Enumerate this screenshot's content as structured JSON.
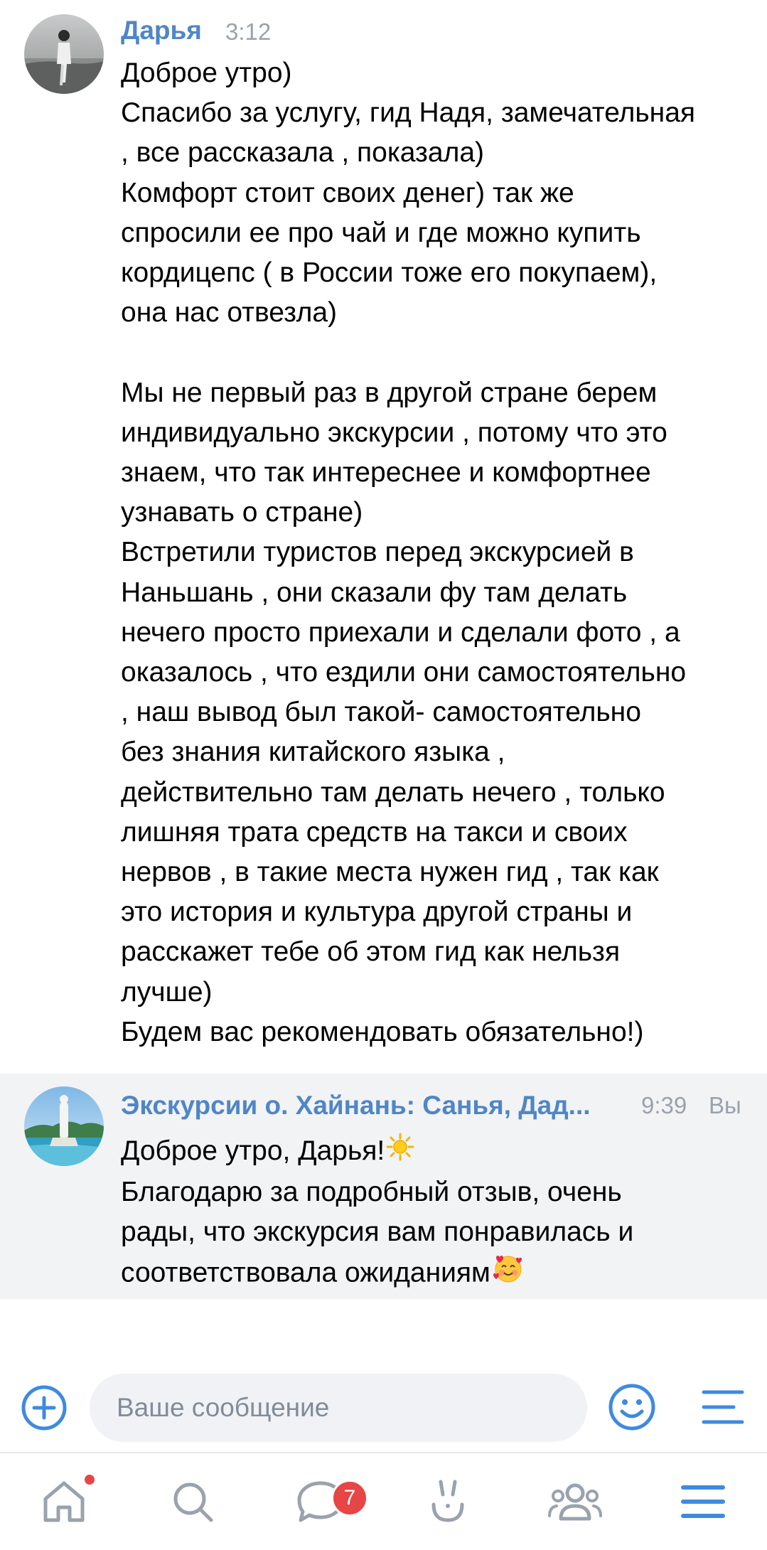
{
  "messages": [
    {
      "author": "Дарья",
      "time": "3:12",
      "lines": [
        "Доброе утро)",
        "Спасибо за услугу, гид Надя, замечательная",
        ", все рассказала , показала)",
        "Комфорт стоит своих денег) так же",
        "спросили ее про чай и где можно купить",
        "кордицепс ( в России тоже его покупаем),",
        "она нас отвезла)",
        "",
        "Мы не первый раз в другой стране берем",
        "индивидуально экскурсии , потому что это",
        "знаем, что так интереснее и комфортнее",
        "узнавать о стране)",
        "Встретили туристов перед экскурсией в",
        "Наньшань , они сказали фу там делать",
        "нечего просто приехали и сделали фото , а",
        "оказалось , что ездили они самостоятельно",
        ", наш вывод был такой- самостоятельно",
        "без знания китайского языка ,",
        "действительно там делать нечего , только",
        "лишняя трата средств на такси и своих",
        "нервов , в такие места нужен гид , так как",
        "это история и культура другой страны и",
        "расскажет тебе об этом гид как нельзя",
        "лучше)",
        "Будем вас рекомендовать обязательно!)"
      ]
    },
    {
      "author": "Экскурсии о. Хайнань: Санья, Дад...",
      "time": "9:39",
      "you_label": "Вы",
      "lines": [
        "Доброе утро, Дарья!",
        "Благодарю за подробный отзыв, очень",
        "рады, что экскурсия вам понравилась и",
        "соответствовала ожиданиям"
      ],
      "emojis": [
        "sun-emoji",
        "smiling-face-with-hearts-emoji"
      ]
    }
  ],
  "composer": {
    "placeholder": "Ваше сообщение",
    "value": ""
  },
  "nav": {
    "items": [
      "home-icon",
      "search-icon",
      "messages-icon",
      "clips-icon",
      "friends-icon",
      "menu-icon"
    ],
    "messages_badge": "7",
    "home_has_notification_dot": true
  },
  "colors": {
    "accent": "#4f86c6",
    "icon_blue": "#3f8ae0",
    "nav_icon": "#99a2ad",
    "badge": "#e64646",
    "reply_background": "#f2f3f5"
  }
}
